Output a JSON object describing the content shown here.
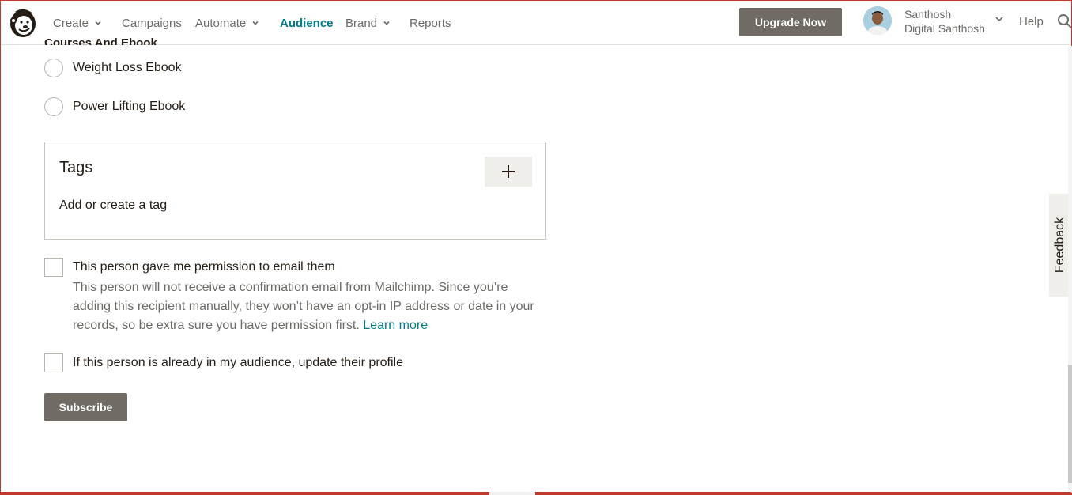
{
  "nav": {
    "items": [
      {
        "label": "Create",
        "has_menu": true
      },
      {
        "label": "Campaigns",
        "has_menu": false
      },
      {
        "label": "Automate",
        "has_menu": true
      },
      {
        "label": "Audience",
        "has_menu": false,
        "active": true
      },
      {
        "label": "Brand",
        "has_menu": true
      },
      {
        "label": "Reports",
        "has_menu": false
      }
    ],
    "upgrade_label": "Upgrade Now",
    "user_name": "Santhosh",
    "user_account": "Digital Santhosh",
    "help_label": "Help",
    "icons": {
      "logo": "mailchimp-freddie-logo",
      "search": "search-icon",
      "chevron": "chevron-down-icon"
    }
  },
  "form": {
    "group_label_cut": "Courses And Ebook",
    "options": [
      {
        "label": "Weight Loss Ebook",
        "selected": false
      },
      {
        "label": "Power Lifting Ebook",
        "selected": false
      }
    ],
    "tags": {
      "title": "Tags",
      "add_icon": "plus-icon",
      "placeholder": "Add or create a tag"
    },
    "permission": {
      "label": "This person gave me permission to email them",
      "checked": false,
      "help_text": "This person will not receive a confirmation email from Mailchimp. Since you’re adding this recipient manually, they won’t have an opt-in IP address or date in your records, so be extra sure you have permission first.",
      "learn_more": "Learn more"
    },
    "update_profile": {
      "label": "If this person is already in my audience, update their profile",
      "checked": false
    },
    "submit_label": "Subscribe"
  },
  "feedback_label": "Feedback",
  "colors": {
    "accent_teal": "#007c89",
    "button_gray": "#706c65",
    "text_dark": "#241c15",
    "text_muted": "#6b6a67"
  }
}
